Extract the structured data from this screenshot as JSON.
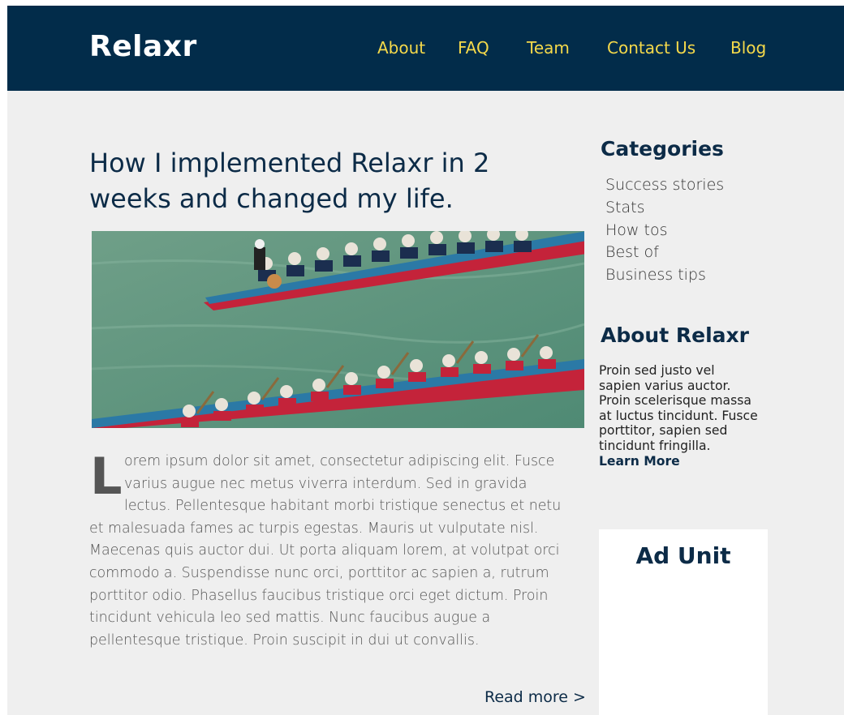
{
  "header": {
    "logo": "Relaxr",
    "nav": [
      {
        "label": "About"
      },
      {
        "label": "FAQ"
      },
      {
        "label": "Team"
      },
      {
        "label": "Contact Us"
      },
      {
        "label": "Blog"
      }
    ]
  },
  "article": {
    "title": "How I implemented Relaxr in 2 weeks and changed my life.",
    "drop_cap": "L",
    "body_lines": [
      "orem ipsum dolor sit amet, consectetur adipiscing elit. Fusce",
      "varius augue nec metus viverra interdum. Sed in gravida",
      "lectus. Pellentesque habitant morbi tristique senectus et netu",
      "et malesuada fames ac turpis egestas. Mauris ut vulputate nisl.",
      "Maecenas quis auctor dui. Ut porta aliquam lorem, at volutpat orci",
      "commodo a. Suspendisse nunc orci, porttitor ac sapien a, rutrum",
      "porttitor odio. Phasellus faucibus tristique orci eget dictum. Proin",
      "tincidunt vehicula leo sed mattis. Nunc faucibus augue a",
      "pellentesque tristique. Proin suscipit in dui ut convallis."
    ],
    "read_more": "Read more >"
  },
  "sidebar": {
    "categories_heading": "Categories",
    "categories": [
      "Success stories",
      "Stats",
      "How tos",
      "Best of",
      "Business tips"
    ],
    "about_heading": "About Relaxr",
    "about_lines": [
      "Proin sed justo vel",
      "sapien varius auctor.",
      "Proin scelerisque massa",
      "at luctus tincidunt. Fusce",
      "porttitor, sapien sed",
      "tincidunt fringilla."
    ],
    "learn_more": "Learn More",
    "ad_title": "Ad Unit"
  },
  "colors": {
    "header_bg": "#022c4a",
    "nav_link": "#f5d94a",
    "heading": "#0c2b47",
    "page_bg": "#efefef"
  }
}
